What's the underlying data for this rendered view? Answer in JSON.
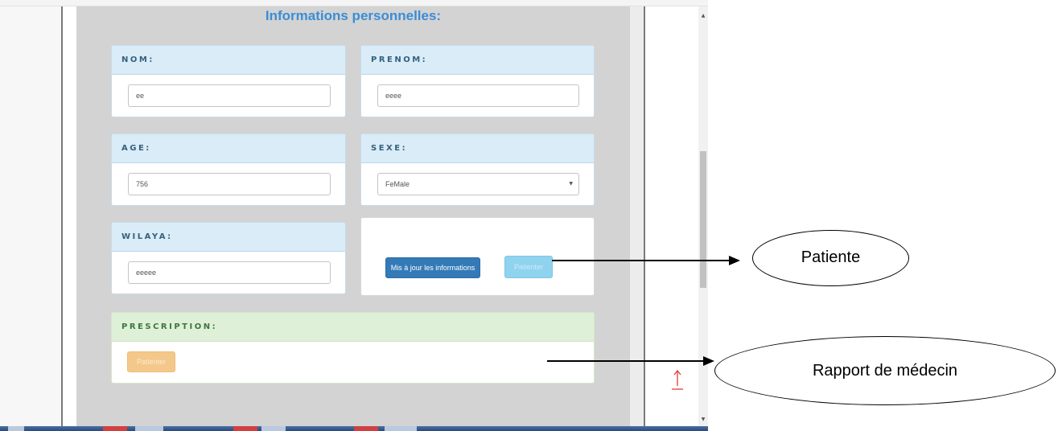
{
  "form": {
    "section_title": "Informations personnelles:",
    "nom": {
      "label": "NOM:",
      "value": "ee"
    },
    "prenom": {
      "label": "PRENOM:",
      "value": "eeee"
    },
    "age": {
      "label": "AGE:",
      "value": "756"
    },
    "sexe": {
      "label": "SEXE:",
      "selected": "FeMale"
    },
    "wilaya": {
      "label": "WILAYA:",
      "value": "eeeee"
    },
    "update_button": "Mis à jour les informations",
    "wait_button": "Patienter"
  },
  "prescription": {
    "label": "PRESCRIPTION:",
    "wait_button": "Patienter"
  },
  "annotations": {
    "patient_callout": "Patiente",
    "doctor_report_callout": "Rapport de médecin"
  },
  "colors": {
    "title_blue": "#3a8dd6",
    "panel_header_blue": "#d9ecf7",
    "panel_header_green": "#dff0d8",
    "primary_button": "#337ab7",
    "info_button": "#8fd3ef",
    "warning_button": "#f4c88a",
    "back_to_top": "#e53935"
  },
  "icons": {
    "back_to_top": "arrow-up-icon",
    "select_caret": "caret-down-icon"
  }
}
